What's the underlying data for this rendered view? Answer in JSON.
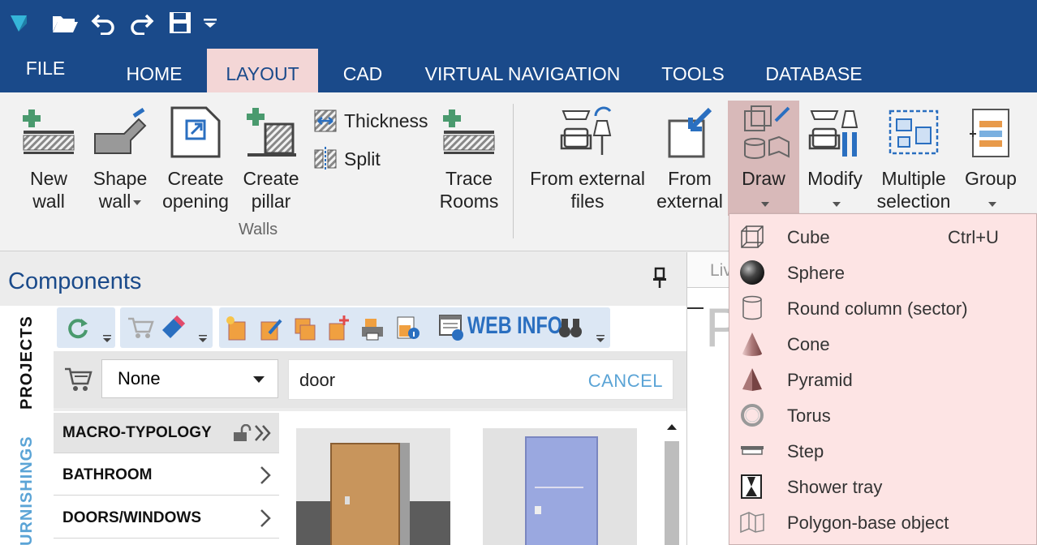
{
  "quick_access": {
    "icons": [
      "app-logo-icon",
      "open-folder-icon",
      "undo-icon",
      "redo-icon",
      "save-icon",
      "customize-dropdown-icon"
    ]
  },
  "tabs": [
    {
      "label": "FILE"
    },
    {
      "label": "HOME"
    },
    {
      "label": "LAYOUT"
    },
    {
      "label": "CAD"
    },
    {
      "label": "VIRTUAL NAVIGATION"
    },
    {
      "label": "TOOLS"
    },
    {
      "label": "DATABASE"
    }
  ],
  "active_tab": "LAYOUT",
  "ribbon": {
    "new_wall": "New\nwall",
    "shape_wall": "Shape\nwall",
    "create_opening": "Create\nopening",
    "create_pillar": "Create\npillar",
    "thickness": "Thickness",
    "split": "Split",
    "trace_rooms": "Trace\nRooms",
    "walls_group": "Walls",
    "from_external_files": "From external\nfiles",
    "from_external": "From\nexternal",
    "draw": "Draw",
    "modify": "Modify",
    "multiple_selection": "Multiple\nselection",
    "group": "Group"
  },
  "components": {
    "title": "Components",
    "side_tabs": {
      "projects": "PROJECTS",
      "furnishings": "URNISHINGS"
    },
    "web_info": "WEB INFO",
    "select_value": "None",
    "search_value": "door",
    "cancel_label": "CANCEL",
    "categories": [
      {
        "label": "MACRO-TYPOLOGY"
      },
      {
        "label": "BATHROOM"
      },
      {
        "label": "DOORS/WINDOWS"
      }
    ]
  },
  "right_panel": {
    "tab_label": "Liv",
    "big_letter": "P"
  },
  "draw_menu": {
    "items": [
      {
        "label": "Cube",
        "shortcut": "Ctrl+U",
        "icon": "cube-icon"
      },
      {
        "label": "Sphere",
        "shortcut": "",
        "icon": "sphere-icon"
      },
      {
        "label": "Round column (sector)",
        "shortcut": "",
        "icon": "cylinder-icon"
      },
      {
        "label": "Cone",
        "shortcut": "",
        "icon": "cone-icon"
      },
      {
        "label": "Pyramid",
        "shortcut": "",
        "icon": "pyramid-icon"
      },
      {
        "label": "Torus",
        "shortcut": "",
        "icon": "torus-icon"
      },
      {
        "label": "Step",
        "shortcut": "",
        "icon": "step-icon"
      },
      {
        "label": "Shower tray",
        "shortcut": "",
        "icon": "shower-tray-icon"
      },
      {
        "label": "Polygon-base object",
        "shortcut": "",
        "icon": "polygon-base-icon"
      }
    ]
  },
  "colors": {
    "title_bar": "#1a4a8a",
    "active_tab": "#f3d6d6",
    "menu_bg": "#fde4e4",
    "accent_green": "#4a9a6e",
    "cancel_blue": "#5ba4d6"
  }
}
